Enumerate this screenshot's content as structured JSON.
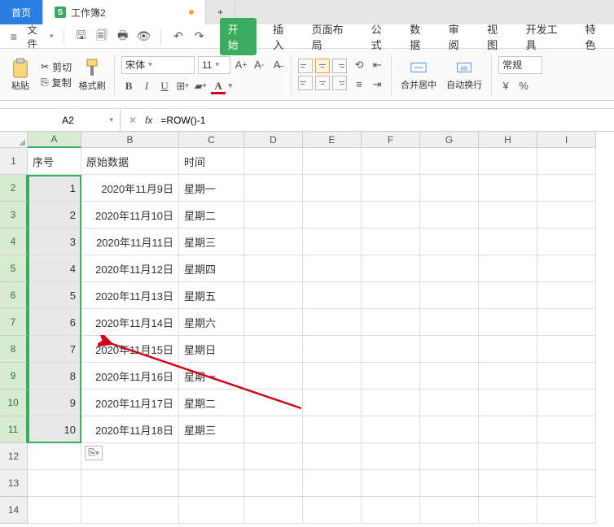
{
  "tabs": {
    "home": "首页",
    "doc": "工作簿2",
    "plus": "+"
  },
  "file_menu": "文件",
  "menu": {
    "start": "开始",
    "insert": "插入",
    "layout": "页面布局",
    "formula": "公式",
    "data": "数据",
    "review": "审阅",
    "view": "视图",
    "dev": "开发工具",
    "special": "特色"
  },
  "ribbon": {
    "paste": "粘贴",
    "cut": "剪切",
    "copy": "复制",
    "format_painter": "格式刷",
    "font_name": "宋体",
    "font_size": "11",
    "merge": "合并居中",
    "wrap": "自动换行",
    "general": "常规"
  },
  "name_box": "A2",
  "formula": "=ROW()-1",
  "columns": [
    "A",
    "B",
    "C",
    "D",
    "E",
    "F",
    "G",
    "H",
    "I"
  ],
  "header_row": {
    "A": "序号",
    "B": "原始数据",
    "C": "时间"
  },
  "rows": [
    {
      "n": 1,
      "A": "1",
      "B": "2020年11月9日",
      "C": "星期一"
    },
    {
      "n": 2,
      "A": "2",
      "B": "2020年11月10日",
      "C": "星期二"
    },
    {
      "n": 3,
      "A": "3",
      "B": "2020年11月11日",
      "C": "星期三"
    },
    {
      "n": 4,
      "A": "4",
      "B": "2020年11月12日",
      "C": "星期四"
    },
    {
      "n": 5,
      "A": "5",
      "B": "2020年11月13日",
      "C": "星期五"
    },
    {
      "n": 6,
      "A": "6",
      "B": "2020年11月14日",
      "C": "星期六"
    },
    {
      "n": 7,
      "A": "7",
      "B": "2020年11月15日",
      "C": "星期日"
    },
    {
      "n": 8,
      "A": "8",
      "B": "2020年11月16日",
      "C": "星期一"
    },
    {
      "n": 9,
      "A": "9",
      "B": "2020年11月17日",
      "C": "星期二"
    },
    {
      "n": 10,
      "A": "10",
      "B": "2020年11月18日",
      "C": "星期三"
    }
  ],
  "empty_rows": [
    12,
    13,
    14
  ],
  "fill_options_icon": "⎘"
}
